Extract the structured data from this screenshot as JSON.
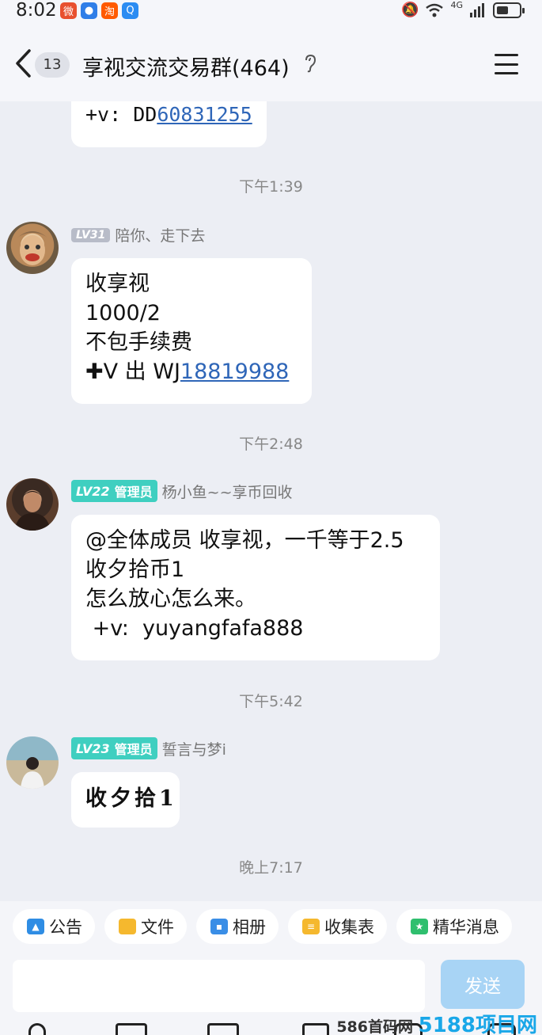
{
  "status_bar": {
    "time": "8:02",
    "network": "4G",
    "apps": [
      {
        "icon": "weibo-icon",
        "glyph": "微",
        "color": "#e8502f"
      },
      {
        "icon": "browser-icon",
        "glyph": "●",
        "color": "#2f7ee8"
      },
      {
        "icon": "taobao-icon",
        "glyph": "淘",
        "color": "#ff5a00"
      },
      {
        "icon": "search-app-icon",
        "glyph": "Q",
        "color": "#2b8cf2"
      }
    ]
  },
  "header": {
    "unread_count": "13",
    "title": "享视交流交易群(464)"
  },
  "messages": {
    "m0": {
      "prefix": "+v:  DD",
      "link": "60831255"
    },
    "t1": "下午1:39",
    "m1": {
      "level": "LV31",
      "sender": "陪你、走下去",
      "lines": [
        "收享视",
        "1000/2",
        "不包手续费"
      ],
      "last_prefix": "✚V 出 WJ",
      "link": "18819988"
    },
    "t2": "下午2:48",
    "m2": {
      "level": "LV22",
      "role": "管理员",
      "sender": "杨小鱼~~享币回收",
      "lines": [
        "@全体成员 收享视，一千等于2.5",
        "收夕拾币1",
        "怎么放心怎么来。",
        " +v:  yuyangfafa888"
      ]
    },
    "t3": "下午5:42",
    "m3": {
      "level": "LV23",
      "role": "管理员",
      "sender": "誓言与梦i",
      "text": "收夕拾1"
    },
    "t4": "晚上7:17"
  },
  "toolbar": {
    "chips": [
      {
        "label": "公告",
        "icon": "announcement-icon",
        "color": "#2f8de4"
      },
      {
        "label": "文件",
        "icon": "folder-icon",
        "color": "#f5b82e"
      },
      {
        "label": "相册",
        "icon": "album-icon",
        "color": "#3a8ee6"
      },
      {
        "label": "收集表",
        "icon": "form-icon",
        "color": "#f5b82e"
      },
      {
        "label": "精华消息",
        "icon": "highlight-icon",
        "color": "#2fbf6e"
      }
    ],
    "send_label": "发送"
  },
  "watermark": {
    "text": "586首码网",
    "brand": "5188项目网"
  }
}
